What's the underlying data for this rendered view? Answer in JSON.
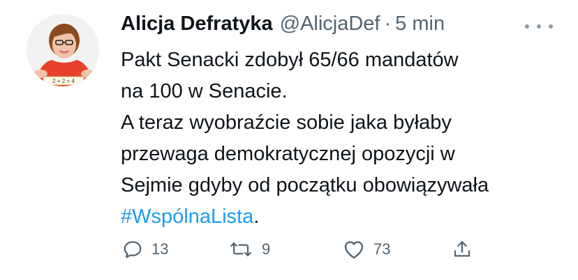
{
  "author": {
    "name": "Alicja Defratyka",
    "handle": "@AlicjaDef",
    "separator": "·",
    "time": "5 min"
  },
  "avatar": {
    "sign_text": "2 + 2 = 4"
  },
  "tweet": {
    "line1": "Pakt Senacki zdobył 65/66 mandatów",
    "line2": "na 100 w Senacie.",
    "line3": "A teraz wyobraźcie sobie jaka byłaby",
    "line4": "przewaga demokratycznej opozycji w",
    "line5": "Sejmie gdyby od początku obowiązywała",
    "hashtag": "#WspólnaLista",
    "after_hashtag": "."
  },
  "actions": {
    "replies": "13",
    "retweets": "9",
    "likes": "73"
  },
  "icons": {
    "more": "more-icon",
    "reply": "reply-icon",
    "retweet": "retweet-icon",
    "like": "heart-icon",
    "share": "share-icon"
  },
  "colors": {
    "text": "#0f1419",
    "secondary": "#536471",
    "link": "#1d9bf0"
  }
}
